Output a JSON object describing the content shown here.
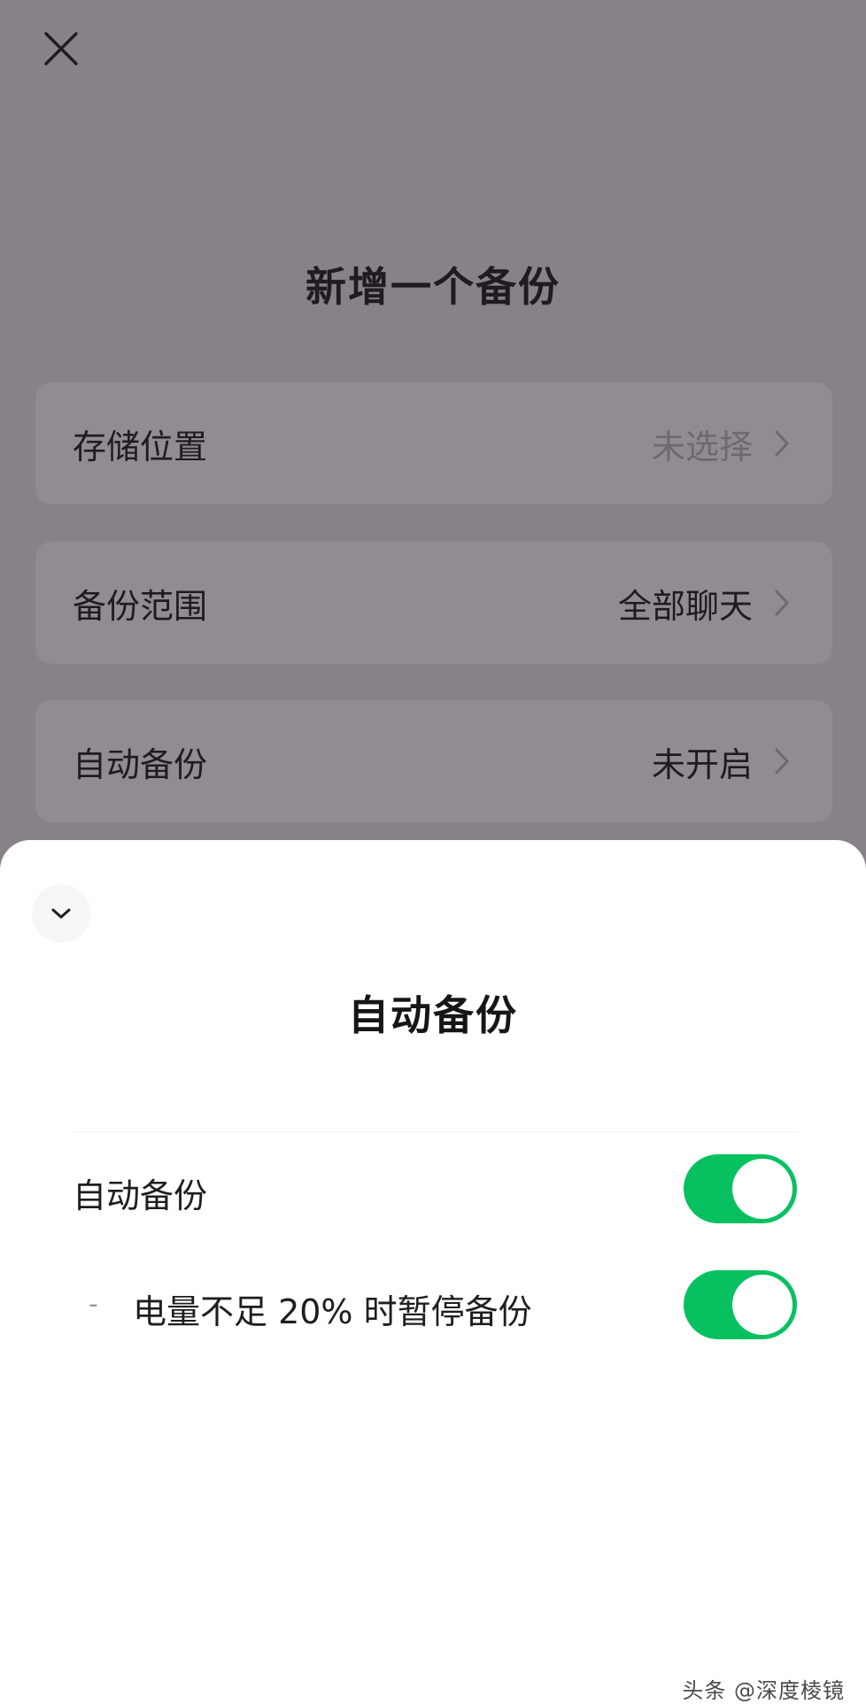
{
  "page": {
    "title": "新增一个备份",
    "close_icon": "close-icon"
  },
  "settings": [
    {
      "label": "存储位置",
      "value": "未选择",
      "value_muted": true
    },
    {
      "label": "备份范围",
      "value": "全部聊天",
      "value_muted": false
    },
    {
      "label": "自动备份",
      "value": "未开启",
      "value_muted": false
    }
  ],
  "sheet": {
    "title": "自动备份",
    "collapse_icon": "chevron-down-icon",
    "options": [
      {
        "label": "自动备份",
        "enabled": true
      },
      {
        "label": "电量不足 20% 时暂停备份",
        "prefix": "-",
        "enabled": true
      }
    ]
  },
  "colors": {
    "accent": "#07c160",
    "overlay": "#898188",
    "row_bg": "#938b92"
  },
  "watermark": "头条 @深度棱镜"
}
